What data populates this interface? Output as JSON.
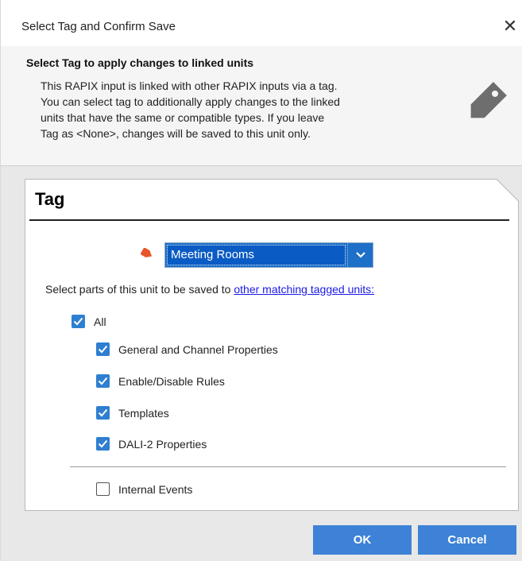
{
  "window": {
    "title": "Select Tag and Confirm Save",
    "close_glyph": "✕"
  },
  "header": {
    "title": "Select Tag to apply changes to linked units",
    "lines": [
      "This RAPIX input is linked with other RAPIX inputs via a tag.",
      "You can select tag to additionally apply changes to the linked",
      "units that have the same or compatible types. If you leave",
      "Tag as <None>, changes will be saved to this unit only."
    ],
    "icon": "tag-icon"
  },
  "panel": {
    "title": "Tag",
    "tag_select": {
      "value": "Meeting Rooms",
      "icon": "tag-icon",
      "button_icon": "chevron-down-icon"
    },
    "select_text": "Select parts of this unit to be saved to ",
    "select_link": "other matching tagged units:",
    "all": {
      "label": "All",
      "checked": true
    },
    "options": [
      {
        "label": "General and Channel Properties",
        "checked": true
      },
      {
        "label": "Enable/Disable Rules",
        "checked": true
      },
      {
        "label": "Templates",
        "checked": true
      },
      {
        "label": "DALI-2 Properties",
        "checked": true
      }
    ],
    "internal_events": {
      "label": "Internal Events",
      "checked": false
    }
  },
  "buttons": {
    "ok": "OK",
    "cancel": "Cancel"
  },
  "colors": {
    "accent": "#3d82d6",
    "checkbox": "#2f7fd1",
    "link": "#1a1ae6",
    "tag_orange": "#e8542a",
    "tag_gray": "#6e6e6e"
  }
}
